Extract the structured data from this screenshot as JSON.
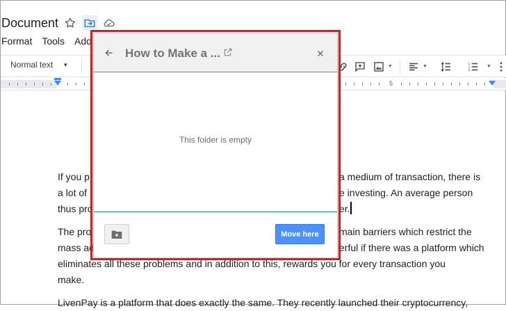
{
  "doc": {
    "title": "Document",
    "menu": [
      "Format",
      "Tools",
      "Add"
    ]
  },
  "toolbar": {
    "style_value": "Normal text"
  },
  "ruler": {
    "number": "5"
  },
  "body": {
    "para1_l1": "If you p",
    "para1_l1_right": "a medium of transaction, there is",
    "para1_l2": "a lot of",
    "para1_l2_right": "e investing. An average person",
    "para1_l3": "thus pro",
    "para1_l3_right": "er.",
    "para2_l1": "The pro",
    "para2_l1_right": "main barriers which restrict the",
    "para2_l2": "mass ad",
    "para2_l2_right": "erful if there was a platform which",
    "para2_l3": "eliminates all these problems and in addition to this, rewards you for every transaction you",
    "para2_l4": "make.",
    "para3_l1": "LivenPay is a platform that does exactly the same. They recently launched their cryptocurrency,"
  },
  "dialog": {
    "title": "How to Make a ...",
    "empty_message": "This folder is empty",
    "move_label": "Move here"
  },
  "colors": {
    "accent_blue": "#4d90fe",
    "highlight_red": "#e5191c",
    "footer_line_green": "#0f9d58"
  }
}
